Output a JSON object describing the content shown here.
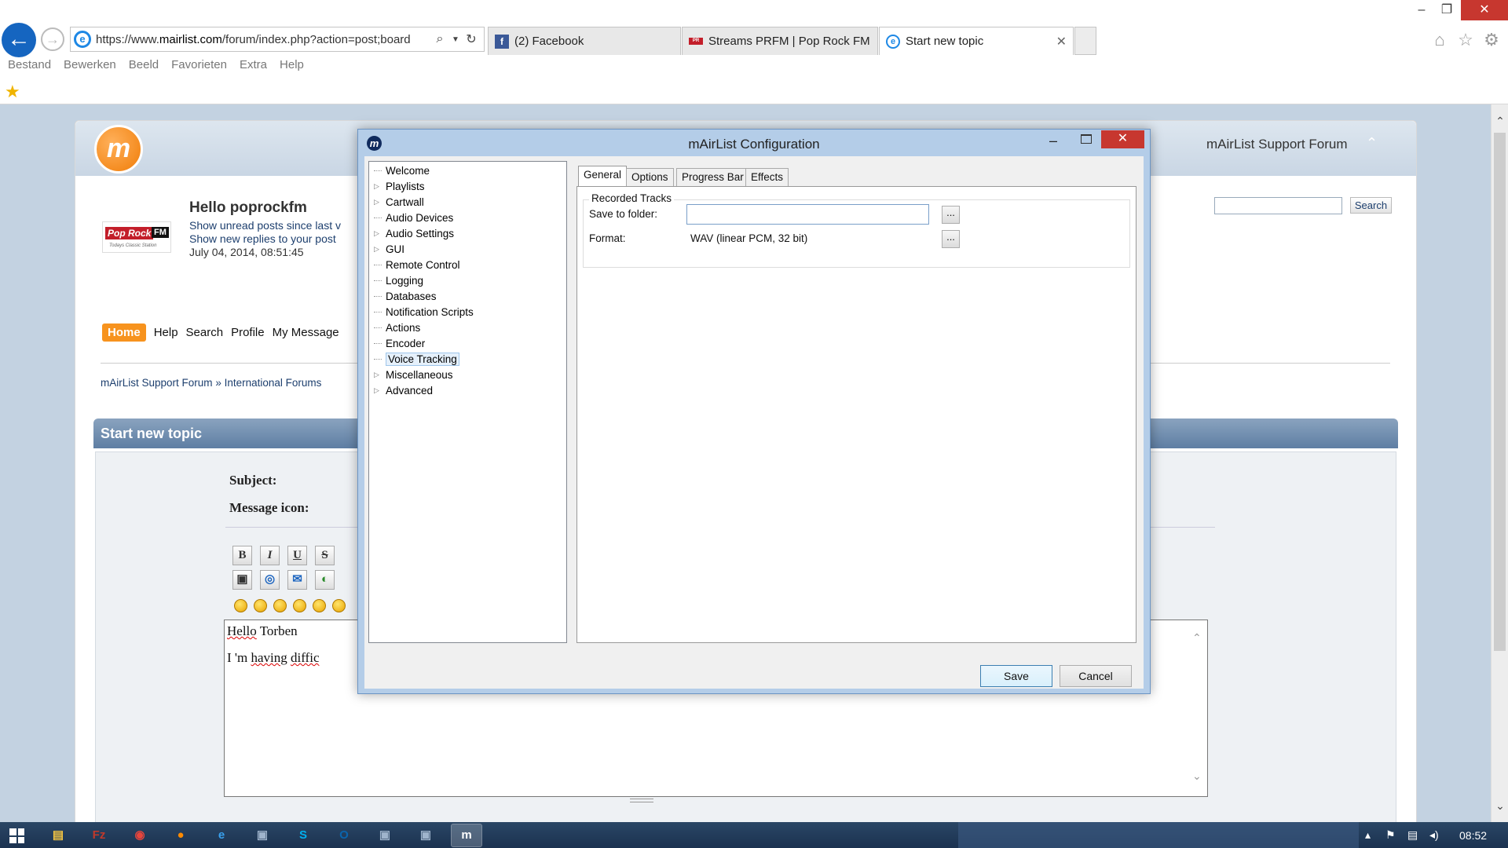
{
  "browser": {
    "url_prefix": "https://www.",
    "url_domain": "mairlist.com",
    "url_suffix": "/forum/index.php?action=post;board",
    "tabs": [
      {
        "label": "(2) Facebook",
        "icon": "facebook-icon"
      },
      {
        "label": "Streams PRFM | Pop Rock FM",
        "icon": "prfm-icon"
      },
      {
        "label": "Start new topic",
        "icon": "ie-icon"
      }
    ],
    "menu": [
      "Bestand",
      "Bewerken",
      "Beeld",
      "Favorieten",
      "Extra",
      "Help"
    ]
  },
  "forum": {
    "site_title": "mAirList Support Forum",
    "hello": "Hello poprockfm",
    "unread_line": "Show unread posts since last v",
    "replies_line": "Show new replies to your post",
    "date": "July 04, 2014, 08:51:45",
    "search_button": "Search",
    "nav": [
      "Home",
      "Help",
      "Search",
      "Profile",
      "My Message"
    ],
    "breadcrumb_1": "mAirList Support Forum",
    "breadcrumb_sep": "»",
    "breadcrumb_2": "International Forums",
    "section_title": "Start new topic",
    "subject_label": "Subject:",
    "message_icon_label": "Message icon:",
    "format_buttons": [
      "B",
      "I",
      "U",
      "S"
    ],
    "message_line1_a": "Hello",
    "message_line1_b": " Torben",
    "message_line2_a": "I 'm ",
    "message_line2_b": "having",
    "message_line2_c": " ",
    "message_line2_d": "diffic"
  },
  "dialog": {
    "title": "mAirList Configuration",
    "tree": [
      {
        "label": "Welcome",
        "expandable": false
      },
      {
        "label": "Playlists",
        "expandable": true
      },
      {
        "label": "Cartwall",
        "expandable": true
      },
      {
        "label": "Audio Devices",
        "expandable": false
      },
      {
        "label": "Audio Settings",
        "expandable": true
      },
      {
        "label": "GUI",
        "expandable": true
      },
      {
        "label": "Remote Control",
        "expandable": false
      },
      {
        "label": "Logging",
        "expandable": false
      },
      {
        "label": "Databases",
        "expandable": false
      },
      {
        "label": "Notification Scripts",
        "expandable": false
      },
      {
        "label": "Actions",
        "expandable": false
      },
      {
        "label": "Encoder",
        "expandable": false
      },
      {
        "label": "Voice Tracking",
        "expandable": false,
        "selected": true
      },
      {
        "label": "Miscellaneous",
        "expandable": true
      },
      {
        "label": "Advanced",
        "expandable": true
      }
    ],
    "tabs": [
      "General",
      "Options",
      "Progress Bar",
      "Effects"
    ],
    "active_tab": "General",
    "group_title": "Recorded Tracks",
    "save_to_folder_label": "Save to folder:",
    "save_to_folder_value": "",
    "format_label": "Format:",
    "format_value": "WAV (linear PCM, 32 bit)",
    "browse_label": "...",
    "save_button": "Save",
    "cancel_button": "Cancel"
  },
  "taskbar": {
    "clock": "08:52",
    "apps": [
      "file-explorer-icon",
      "filezilla-icon",
      "chrome-icon",
      "firefox-icon",
      "internet-explorer-icon",
      "app-icon",
      "skype-icon",
      "outlook-icon",
      "app-icon",
      "app-icon",
      "mairlist-icon"
    ]
  }
}
